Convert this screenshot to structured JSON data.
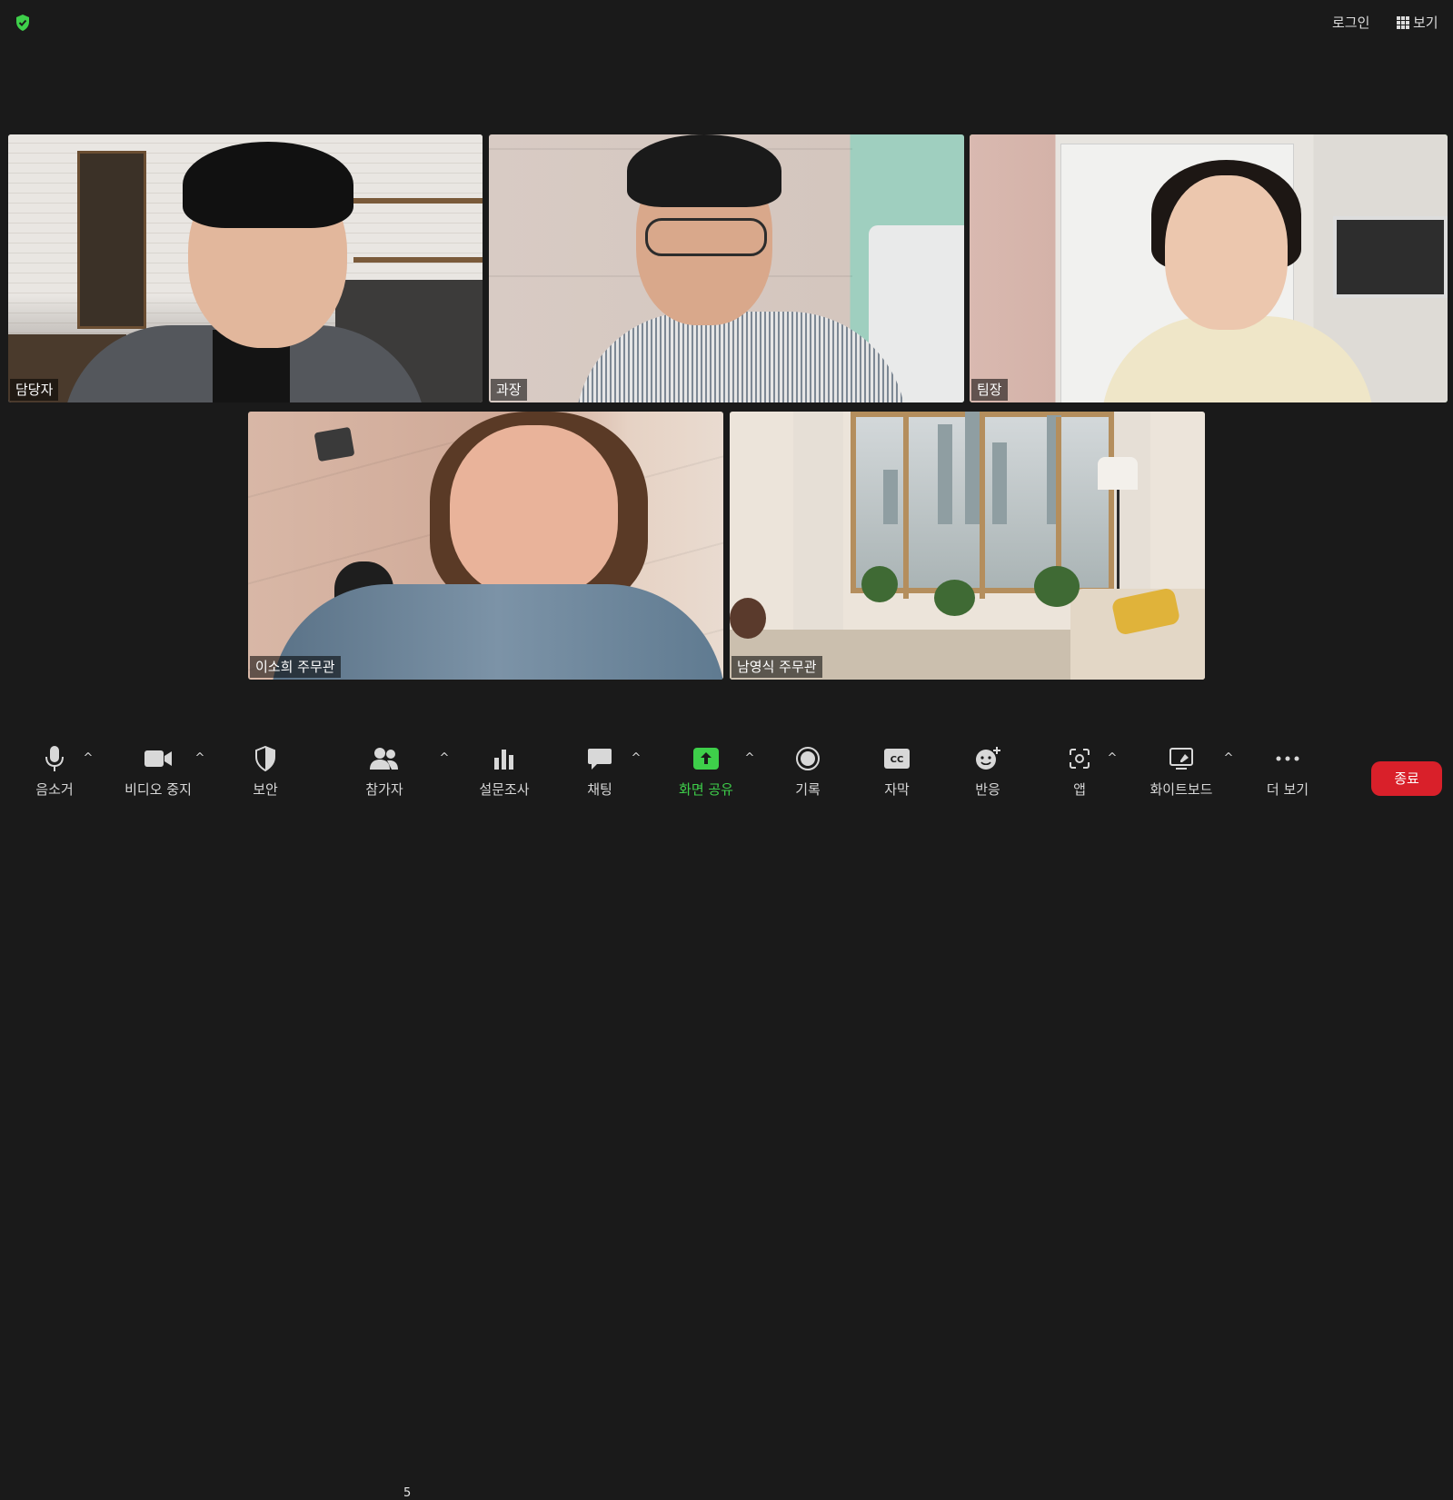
{
  "header": {
    "login_label": "로그인",
    "view_label": "보기"
  },
  "participants": [
    {
      "name": "담당자"
    },
    {
      "name": "과장"
    },
    {
      "name": "팀장",
      "speaking": true
    },
    {
      "name": "이소희 주무관"
    },
    {
      "name": "남영식 주무관"
    }
  ],
  "toolbar": {
    "mute": "음소거",
    "video": "비디오 중지",
    "security": "보안",
    "participants": "참가자",
    "participants_count": "5",
    "polls": "설문조사",
    "chat": "채팅",
    "share": "화면 공유",
    "record": "기록",
    "captions": "자막",
    "reactions": "반응",
    "apps": "앱",
    "whiteboard": "화이트보드",
    "more": "더 보기",
    "end": "종료"
  },
  "colors": {
    "background": "#1a1a1a",
    "accent_green": "#3ecf4a",
    "active_speaker": "#5ac95a",
    "end_red": "#d9202a"
  }
}
